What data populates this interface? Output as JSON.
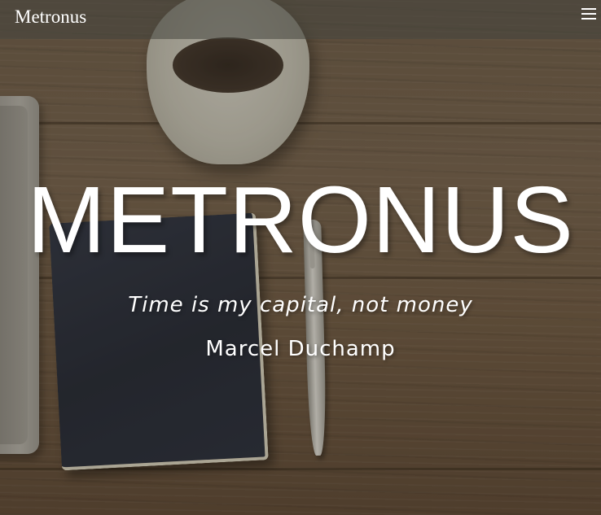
{
  "navbar": {
    "brand": "Metronus",
    "menu_icon": "hamburger-menu-icon"
  },
  "hero": {
    "title": "METRONUS",
    "quote": "Time is my capital, not money",
    "author": "Marcel Duchamp"
  },
  "colors": {
    "text": "#ffffff",
    "navbar_bg": "#46463e",
    "wood": "#6b5a48"
  }
}
